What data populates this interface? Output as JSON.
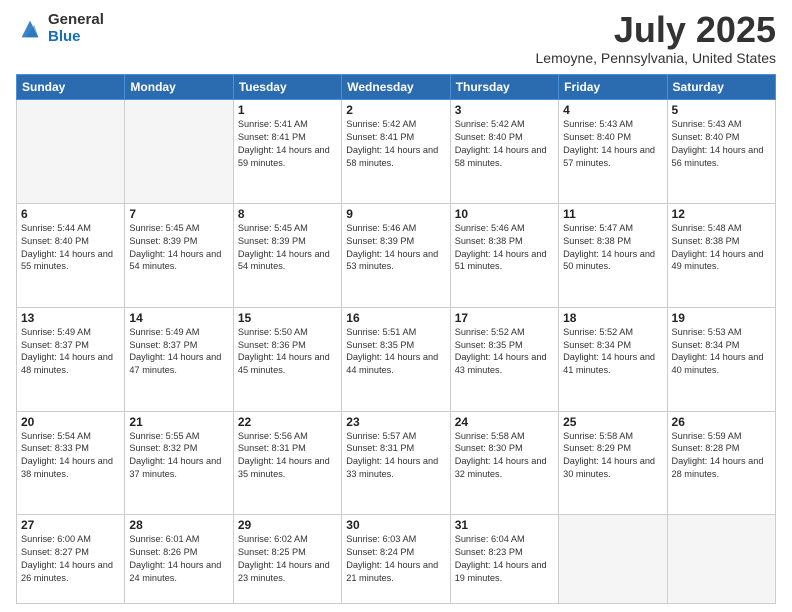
{
  "header": {
    "logo_general": "General",
    "logo_blue": "Blue",
    "month_title": "July 2025",
    "location": "Lemoyne, Pennsylvania, United States"
  },
  "calendar": {
    "days_of_week": [
      "Sunday",
      "Monday",
      "Tuesday",
      "Wednesday",
      "Thursday",
      "Friday",
      "Saturday"
    ],
    "weeks": [
      [
        {
          "day": "",
          "sunrise": "",
          "sunset": "",
          "daylight": "",
          "empty": true
        },
        {
          "day": "",
          "sunrise": "",
          "sunset": "",
          "daylight": "",
          "empty": true
        },
        {
          "day": "1",
          "sunrise": "Sunrise: 5:41 AM",
          "sunset": "Sunset: 8:41 PM",
          "daylight": "Daylight: 14 hours and 59 minutes.",
          "empty": false
        },
        {
          "day": "2",
          "sunrise": "Sunrise: 5:42 AM",
          "sunset": "Sunset: 8:41 PM",
          "daylight": "Daylight: 14 hours and 58 minutes.",
          "empty": false
        },
        {
          "day": "3",
          "sunrise": "Sunrise: 5:42 AM",
          "sunset": "Sunset: 8:40 PM",
          "daylight": "Daylight: 14 hours and 58 minutes.",
          "empty": false
        },
        {
          "day": "4",
          "sunrise": "Sunrise: 5:43 AM",
          "sunset": "Sunset: 8:40 PM",
          "daylight": "Daylight: 14 hours and 57 minutes.",
          "empty": false
        },
        {
          "day": "5",
          "sunrise": "Sunrise: 5:43 AM",
          "sunset": "Sunset: 8:40 PM",
          "daylight": "Daylight: 14 hours and 56 minutes.",
          "empty": false
        }
      ],
      [
        {
          "day": "6",
          "sunrise": "Sunrise: 5:44 AM",
          "sunset": "Sunset: 8:40 PM",
          "daylight": "Daylight: 14 hours and 55 minutes.",
          "empty": false
        },
        {
          "day": "7",
          "sunrise": "Sunrise: 5:45 AM",
          "sunset": "Sunset: 8:39 PM",
          "daylight": "Daylight: 14 hours and 54 minutes.",
          "empty": false
        },
        {
          "day": "8",
          "sunrise": "Sunrise: 5:45 AM",
          "sunset": "Sunset: 8:39 PM",
          "daylight": "Daylight: 14 hours and 54 minutes.",
          "empty": false
        },
        {
          "day": "9",
          "sunrise": "Sunrise: 5:46 AM",
          "sunset": "Sunset: 8:39 PM",
          "daylight": "Daylight: 14 hours and 53 minutes.",
          "empty": false
        },
        {
          "day": "10",
          "sunrise": "Sunrise: 5:46 AM",
          "sunset": "Sunset: 8:38 PM",
          "daylight": "Daylight: 14 hours and 51 minutes.",
          "empty": false
        },
        {
          "day": "11",
          "sunrise": "Sunrise: 5:47 AM",
          "sunset": "Sunset: 8:38 PM",
          "daylight": "Daylight: 14 hours and 50 minutes.",
          "empty": false
        },
        {
          "day": "12",
          "sunrise": "Sunrise: 5:48 AM",
          "sunset": "Sunset: 8:38 PM",
          "daylight": "Daylight: 14 hours and 49 minutes.",
          "empty": false
        }
      ],
      [
        {
          "day": "13",
          "sunrise": "Sunrise: 5:49 AM",
          "sunset": "Sunset: 8:37 PM",
          "daylight": "Daylight: 14 hours and 48 minutes.",
          "empty": false
        },
        {
          "day": "14",
          "sunrise": "Sunrise: 5:49 AM",
          "sunset": "Sunset: 8:37 PM",
          "daylight": "Daylight: 14 hours and 47 minutes.",
          "empty": false
        },
        {
          "day": "15",
          "sunrise": "Sunrise: 5:50 AM",
          "sunset": "Sunset: 8:36 PM",
          "daylight": "Daylight: 14 hours and 45 minutes.",
          "empty": false
        },
        {
          "day": "16",
          "sunrise": "Sunrise: 5:51 AM",
          "sunset": "Sunset: 8:35 PM",
          "daylight": "Daylight: 14 hours and 44 minutes.",
          "empty": false
        },
        {
          "day": "17",
          "sunrise": "Sunrise: 5:52 AM",
          "sunset": "Sunset: 8:35 PM",
          "daylight": "Daylight: 14 hours and 43 minutes.",
          "empty": false
        },
        {
          "day": "18",
          "sunrise": "Sunrise: 5:52 AM",
          "sunset": "Sunset: 8:34 PM",
          "daylight": "Daylight: 14 hours and 41 minutes.",
          "empty": false
        },
        {
          "day": "19",
          "sunrise": "Sunrise: 5:53 AM",
          "sunset": "Sunset: 8:34 PM",
          "daylight": "Daylight: 14 hours and 40 minutes.",
          "empty": false
        }
      ],
      [
        {
          "day": "20",
          "sunrise": "Sunrise: 5:54 AM",
          "sunset": "Sunset: 8:33 PM",
          "daylight": "Daylight: 14 hours and 38 minutes.",
          "empty": false
        },
        {
          "day": "21",
          "sunrise": "Sunrise: 5:55 AM",
          "sunset": "Sunset: 8:32 PM",
          "daylight": "Daylight: 14 hours and 37 minutes.",
          "empty": false
        },
        {
          "day": "22",
          "sunrise": "Sunrise: 5:56 AM",
          "sunset": "Sunset: 8:31 PM",
          "daylight": "Daylight: 14 hours and 35 minutes.",
          "empty": false
        },
        {
          "day": "23",
          "sunrise": "Sunrise: 5:57 AM",
          "sunset": "Sunset: 8:31 PM",
          "daylight": "Daylight: 14 hours and 33 minutes.",
          "empty": false
        },
        {
          "day": "24",
          "sunrise": "Sunrise: 5:58 AM",
          "sunset": "Sunset: 8:30 PM",
          "daylight": "Daylight: 14 hours and 32 minutes.",
          "empty": false
        },
        {
          "day": "25",
          "sunrise": "Sunrise: 5:58 AM",
          "sunset": "Sunset: 8:29 PM",
          "daylight": "Daylight: 14 hours and 30 minutes.",
          "empty": false
        },
        {
          "day": "26",
          "sunrise": "Sunrise: 5:59 AM",
          "sunset": "Sunset: 8:28 PM",
          "daylight": "Daylight: 14 hours and 28 minutes.",
          "empty": false
        }
      ],
      [
        {
          "day": "27",
          "sunrise": "Sunrise: 6:00 AM",
          "sunset": "Sunset: 8:27 PM",
          "daylight": "Daylight: 14 hours and 26 minutes.",
          "empty": false
        },
        {
          "day": "28",
          "sunrise": "Sunrise: 6:01 AM",
          "sunset": "Sunset: 8:26 PM",
          "daylight": "Daylight: 14 hours and 24 minutes.",
          "empty": false
        },
        {
          "day": "29",
          "sunrise": "Sunrise: 6:02 AM",
          "sunset": "Sunset: 8:25 PM",
          "daylight": "Daylight: 14 hours and 23 minutes.",
          "empty": false
        },
        {
          "day": "30",
          "sunrise": "Sunrise: 6:03 AM",
          "sunset": "Sunset: 8:24 PM",
          "daylight": "Daylight: 14 hours and 21 minutes.",
          "empty": false
        },
        {
          "day": "31",
          "sunrise": "Sunrise: 6:04 AM",
          "sunset": "Sunset: 8:23 PM",
          "daylight": "Daylight: 14 hours and 19 minutes.",
          "empty": false
        },
        {
          "day": "",
          "sunrise": "",
          "sunset": "",
          "daylight": "",
          "empty": true
        },
        {
          "day": "",
          "sunrise": "",
          "sunset": "",
          "daylight": "",
          "empty": true
        }
      ]
    ]
  }
}
